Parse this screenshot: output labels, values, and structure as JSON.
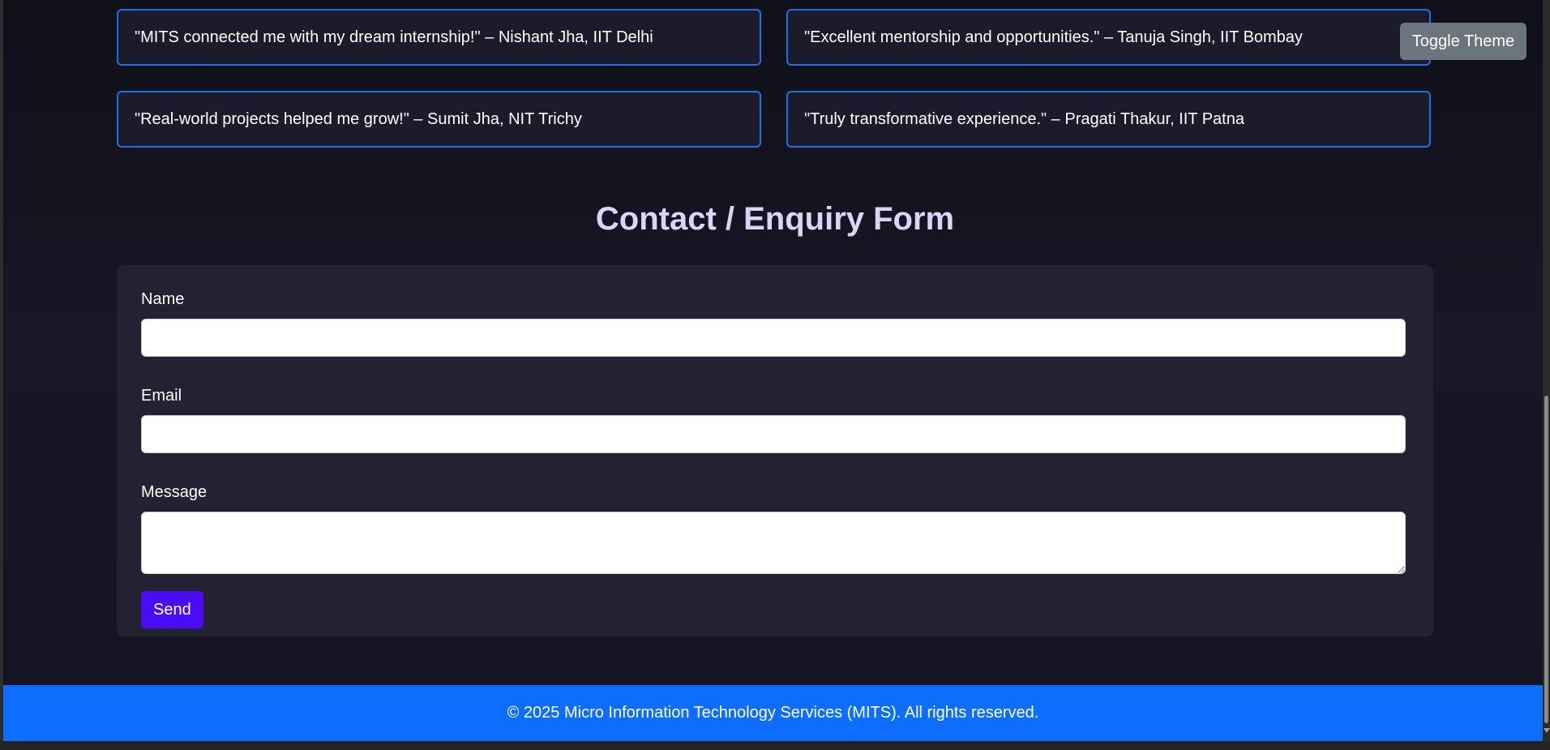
{
  "testimonials": [
    {
      "text": "\"MITS connected me with my dream internship!\" – Nishant Jha, IIT Delhi"
    },
    {
      "text": "\"Excellent mentorship and opportunities.\" – Tanuja Singh, IIT Bombay"
    },
    {
      "text": "\"Real-world projects helped me grow!\" – Sumit Jha, NIT Trichy"
    },
    {
      "text": "\"Truly transformative experience.\" – Pragati Thakur, IIT Patna"
    }
  ],
  "contact": {
    "title": "Contact / Enquiry Form",
    "name_label": "Name",
    "name_value": "",
    "email_label": "Email",
    "email_value": "",
    "message_label": "Message",
    "message_value": "",
    "send_label": "Send"
  },
  "footer": {
    "text": "© 2025 Micro Information Technology Services (MITS). All rights reserved."
  },
  "theme_toggle": {
    "label": "Toggle Theme"
  },
  "colors": {
    "accent_border": "#1f6fe6",
    "footer_bg": "#0d6efd",
    "send_button": "#4a0cf4",
    "toggle_button": "#6c757d",
    "title_text": "#d9d6f5"
  }
}
